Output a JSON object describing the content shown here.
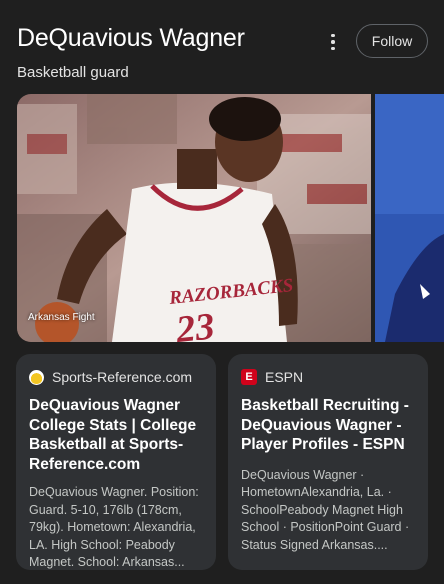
{
  "header": {
    "title": "DeQuavious Wagner",
    "subtitle": "Basketball guard",
    "follow_label": "Follow"
  },
  "images": {
    "main_caption": "Arkansas Fight",
    "jersey_text": "RAZORBACKS",
    "jersey_number": "23"
  },
  "cards": [
    {
      "source": "Sports-Reference.com",
      "title": "DeQuavious Wagner College Stats | College Basketball at Sports-Reference.com",
      "snippet": "DeQuavious Wagner. Position: Guard. 5-10, 176lb (178cm, 79kg). Hometown: Alexandria, LA. High School: Peabody Magnet. School: Arkansas..."
    },
    {
      "source": "ESPN",
      "favicon_letter": "E",
      "title": "Basketball Recruiting - DeQuavious Wagner - Player Profiles - ESPN",
      "snippet": "DeQuavious Wagner · HometownAlexandria, La. · SchoolPeabody Magnet High School · PositionPoint Guard · Status Signed Arkansas...."
    }
  ]
}
